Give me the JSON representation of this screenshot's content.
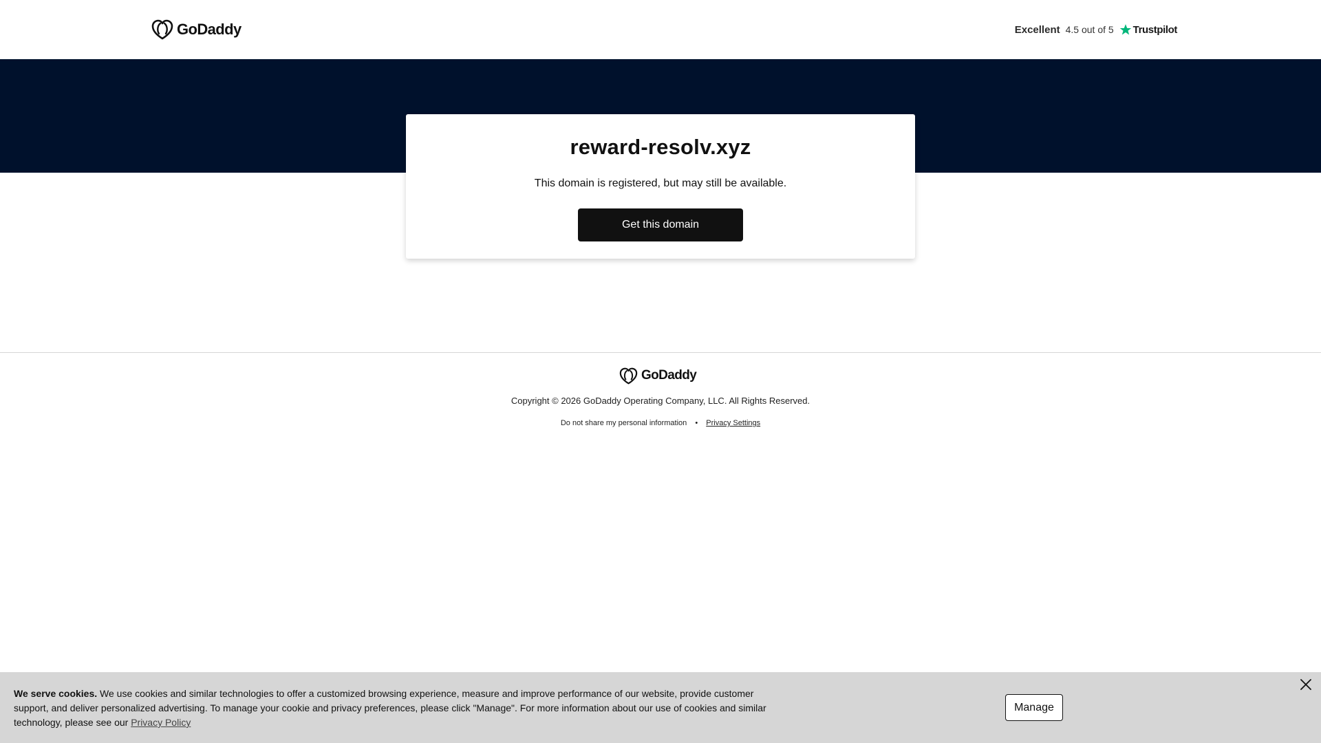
{
  "header": {
    "logo_text": "GoDaddy",
    "trustpilot": {
      "rating_word": "Excellent",
      "score_text": "4.5 out of 5",
      "brand": "Trustpilot",
      "star_color": "#00b67a"
    }
  },
  "hero": {
    "background_color": "#00112c"
  },
  "card": {
    "domain": "reward-resolv.xyz",
    "note": "This domain is registered, but may still be available.",
    "button_label": "Get this domain"
  },
  "footer": {
    "logo_text": "GoDaddy",
    "copyright": "Copyright © 2026 GoDaddy Operating Company, LLC. All Rights Reserved.",
    "do_not_share": "Do not share my personal information",
    "separator": "•",
    "privacy_settings": "Privacy Settings"
  },
  "cookie_banner": {
    "bold_lead": "We serve cookies.",
    "body": " We use cookies and similar technologies to offer a customized browsing experience, measure and improve performance of our website, provide customer support, and deliver personalized advertising. To manage your cookie and privacy preferences, please click \"Manage\". For more information about our use of cookies and similar technology, please see our ",
    "policy_link": "Privacy Policy",
    "manage_label": "Manage",
    "close_icon": "close-icon"
  }
}
